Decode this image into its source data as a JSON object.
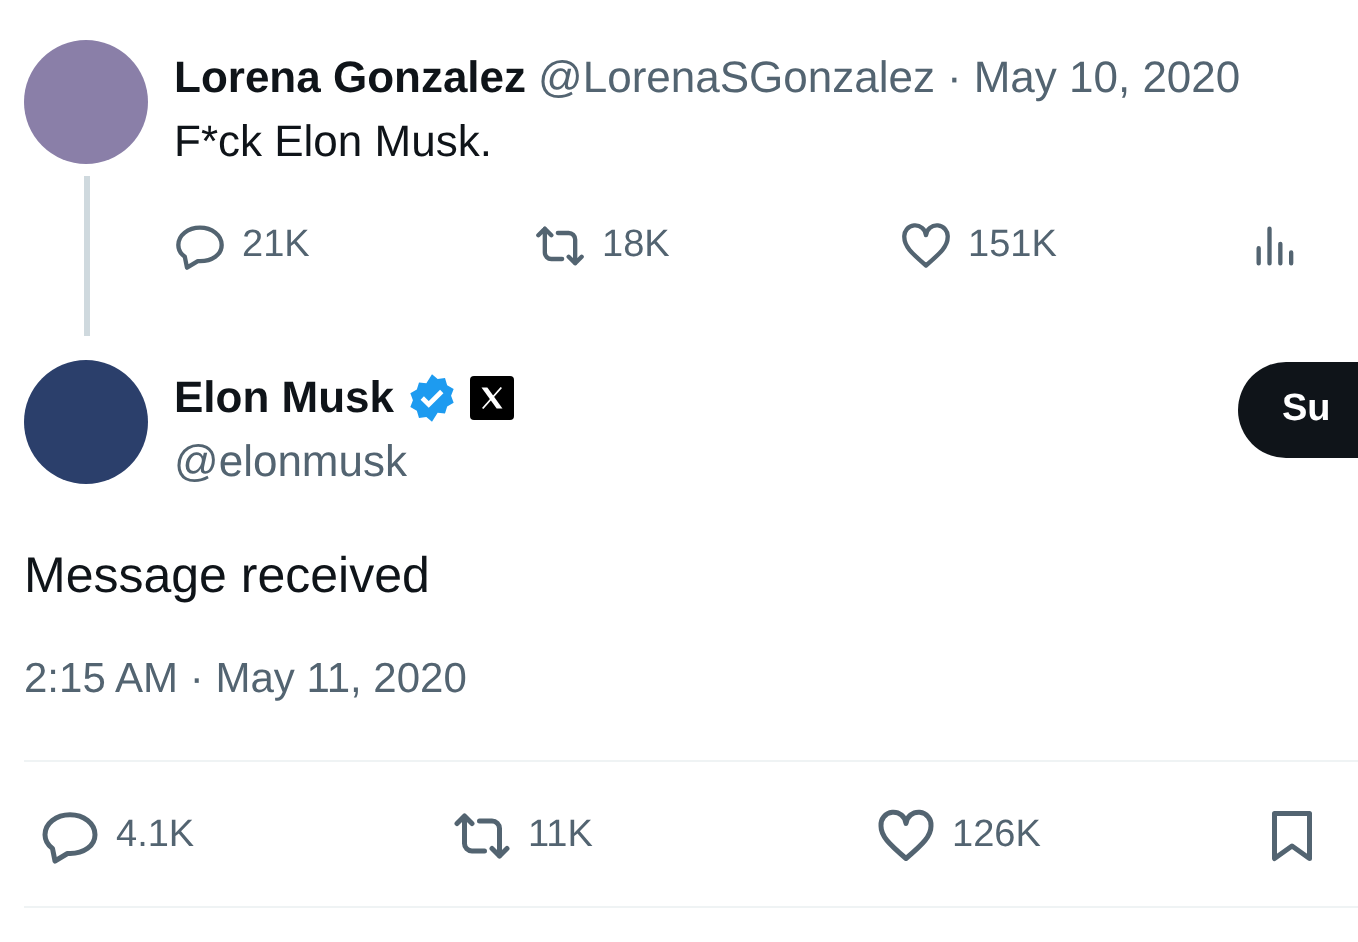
{
  "parent_tweet": {
    "name": "Lorena Gonzalez",
    "handle": "@LorenaSGonzalez",
    "separator": "·",
    "date": "May 10, 2020",
    "text": "F*ck Elon Musk.",
    "actions": [
      {
        "kind": "reply",
        "count": "21K"
      },
      {
        "kind": "repost",
        "count": "18K"
      },
      {
        "kind": "like",
        "count": "151K"
      },
      {
        "kind": "views"
      }
    ]
  },
  "main_tweet": {
    "name": "Elon Musk",
    "verified": true,
    "handle": "@elonmusk",
    "subscribe_button": "Su",
    "text": "Message received",
    "timestamp": "2:15 AM · May 11, 2020",
    "actions": [
      {
        "kind": "reply",
        "count": "4.1K"
      },
      {
        "kind": "repost",
        "count": "11K"
      },
      {
        "kind": "like",
        "count": "126K"
      },
      {
        "kind": "bookmark"
      }
    ]
  }
}
